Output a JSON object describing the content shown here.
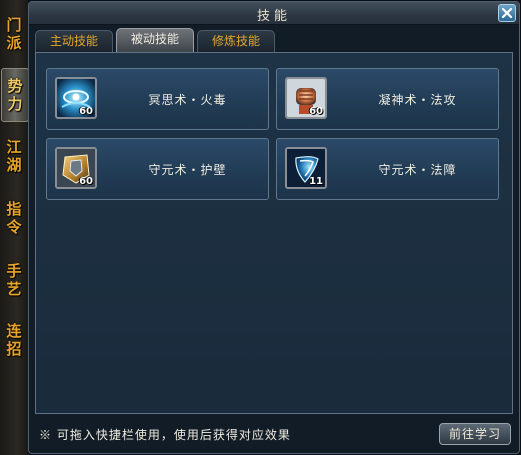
{
  "side_tabs": [
    {
      "label": [
        "门",
        "派"
      ]
    },
    {
      "label": [
        "势",
        "力"
      ]
    },
    {
      "label": [
        "江",
        "湖"
      ]
    },
    {
      "label": [
        "指",
        "令"
      ]
    },
    {
      "label": [
        "手",
        "艺"
      ]
    },
    {
      "label": [
        "连",
        "招"
      ]
    }
  ],
  "window": {
    "title": "技能",
    "close_icon": "close-x-icon"
  },
  "tabs": [
    {
      "label": "主动技能",
      "active": false
    },
    {
      "label": "被动技能",
      "active": true
    },
    {
      "label": "修炼技能",
      "active": false
    }
  ],
  "skills": [
    {
      "name": "冥思术・火毒",
      "level": "60",
      "icon": "swirl-eye-icon"
    },
    {
      "name": "凝神术・法攻",
      "level": "60",
      "icon": "fist-icon"
    },
    {
      "name": "守元术・护壁",
      "level": "60",
      "icon": "shield-armor-icon"
    },
    {
      "name": "守元术・法障",
      "level": "11",
      "icon": "crescent-shield-icon"
    }
  ],
  "footer": {
    "tip": "※ 可拖入快捷栏使用，使用后获得对应效果",
    "learn_button": "前往学习"
  }
}
